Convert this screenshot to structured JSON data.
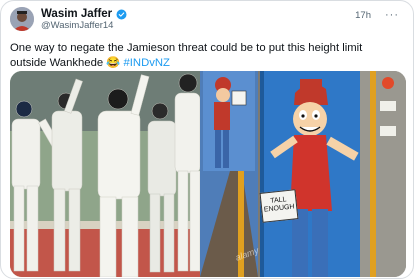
{
  "tweet": {
    "author": {
      "name": "Wasim Jaffer",
      "handle": "@WasimJaffer14",
      "verified_color": "#1d9bf0",
      "avatar_icon": "avatar"
    },
    "time": "17h",
    "more_icon": "more-icon",
    "text": {
      "main": "One way to negate the Jamieson threat could be to put this height limit outside Wankhede 😂 ",
      "hashtag": "#INDvNZ"
    },
    "media": {
      "sign_text": "TALL ENOUGH",
      "watermark": "alamy"
    }
  },
  "colors": {
    "link": "#1d9bf0",
    "text": "#0f1419",
    "secondary": "#536471"
  }
}
